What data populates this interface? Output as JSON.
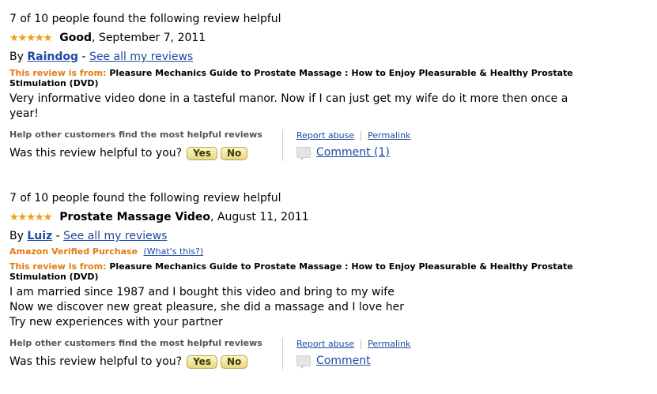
{
  "reviews": [
    {
      "helpful_count": "7 of 10 people found the following review helpful",
      "rating": 5,
      "stars": "★★★★★",
      "title": "Good",
      "date": ", September 7, 2011",
      "by_prefix": "By ",
      "author": "Raindog",
      "dash": " - ",
      "see_all": "See all my reviews",
      "verified_label": "",
      "whats_this": "",
      "from_label": "This review is from: ",
      "product": "Pleasure Mechanics Guide to Prostate Massage : How to Enjoy Pleasurable & Healthy Prostate Stimulation (DVD)",
      "body": [
        "Very informative video done in a tasteful manor. Now if I can just get my wife do it more then once a year!"
      ],
      "help_heading": "Help other customers find the most helpful reviews",
      "was_helpful": "Was this review helpful to you?",
      "yes": "Yes",
      "no": "No",
      "report_abuse": "Report abuse",
      "permalink": "Permalink",
      "comment": "Comment (1)"
    },
    {
      "helpful_count": "7 of 10 people found the following review helpful",
      "rating": 5,
      "stars": "★★★★★",
      "title": "Prostate Massage Video",
      "date": ", August 11, 2011",
      "by_prefix": "By ",
      "author": "Luiz",
      "dash": " - ",
      "see_all": "See all my reviews",
      "verified_label": "Amazon Verified Purchase",
      "whats_this": "(What's this?)",
      "from_label": "This review is from: ",
      "product": "Pleasure Mechanics Guide to Prostate Massage : How to Enjoy Pleasurable & Healthy Prostate Stimulation (DVD)",
      "body": [
        "I am married since 1987 and I bought this video and bring to my wife",
        "Now we discover new great pleasure, she did a massage and I love her",
        "Try new experiences with your partner"
      ],
      "help_heading": "Help other customers find the most helpful reviews",
      "was_helpful": "Was this review helpful to you?",
      "yes": "Yes",
      "no": "No",
      "report_abuse": "Report abuse",
      "permalink": "Permalink",
      "comment": "Comment"
    }
  ],
  "colors": {
    "link": "#1e4aa0",
    "accent_orange": "#e47911",
    "star": "#f0a31c"
  }
}
